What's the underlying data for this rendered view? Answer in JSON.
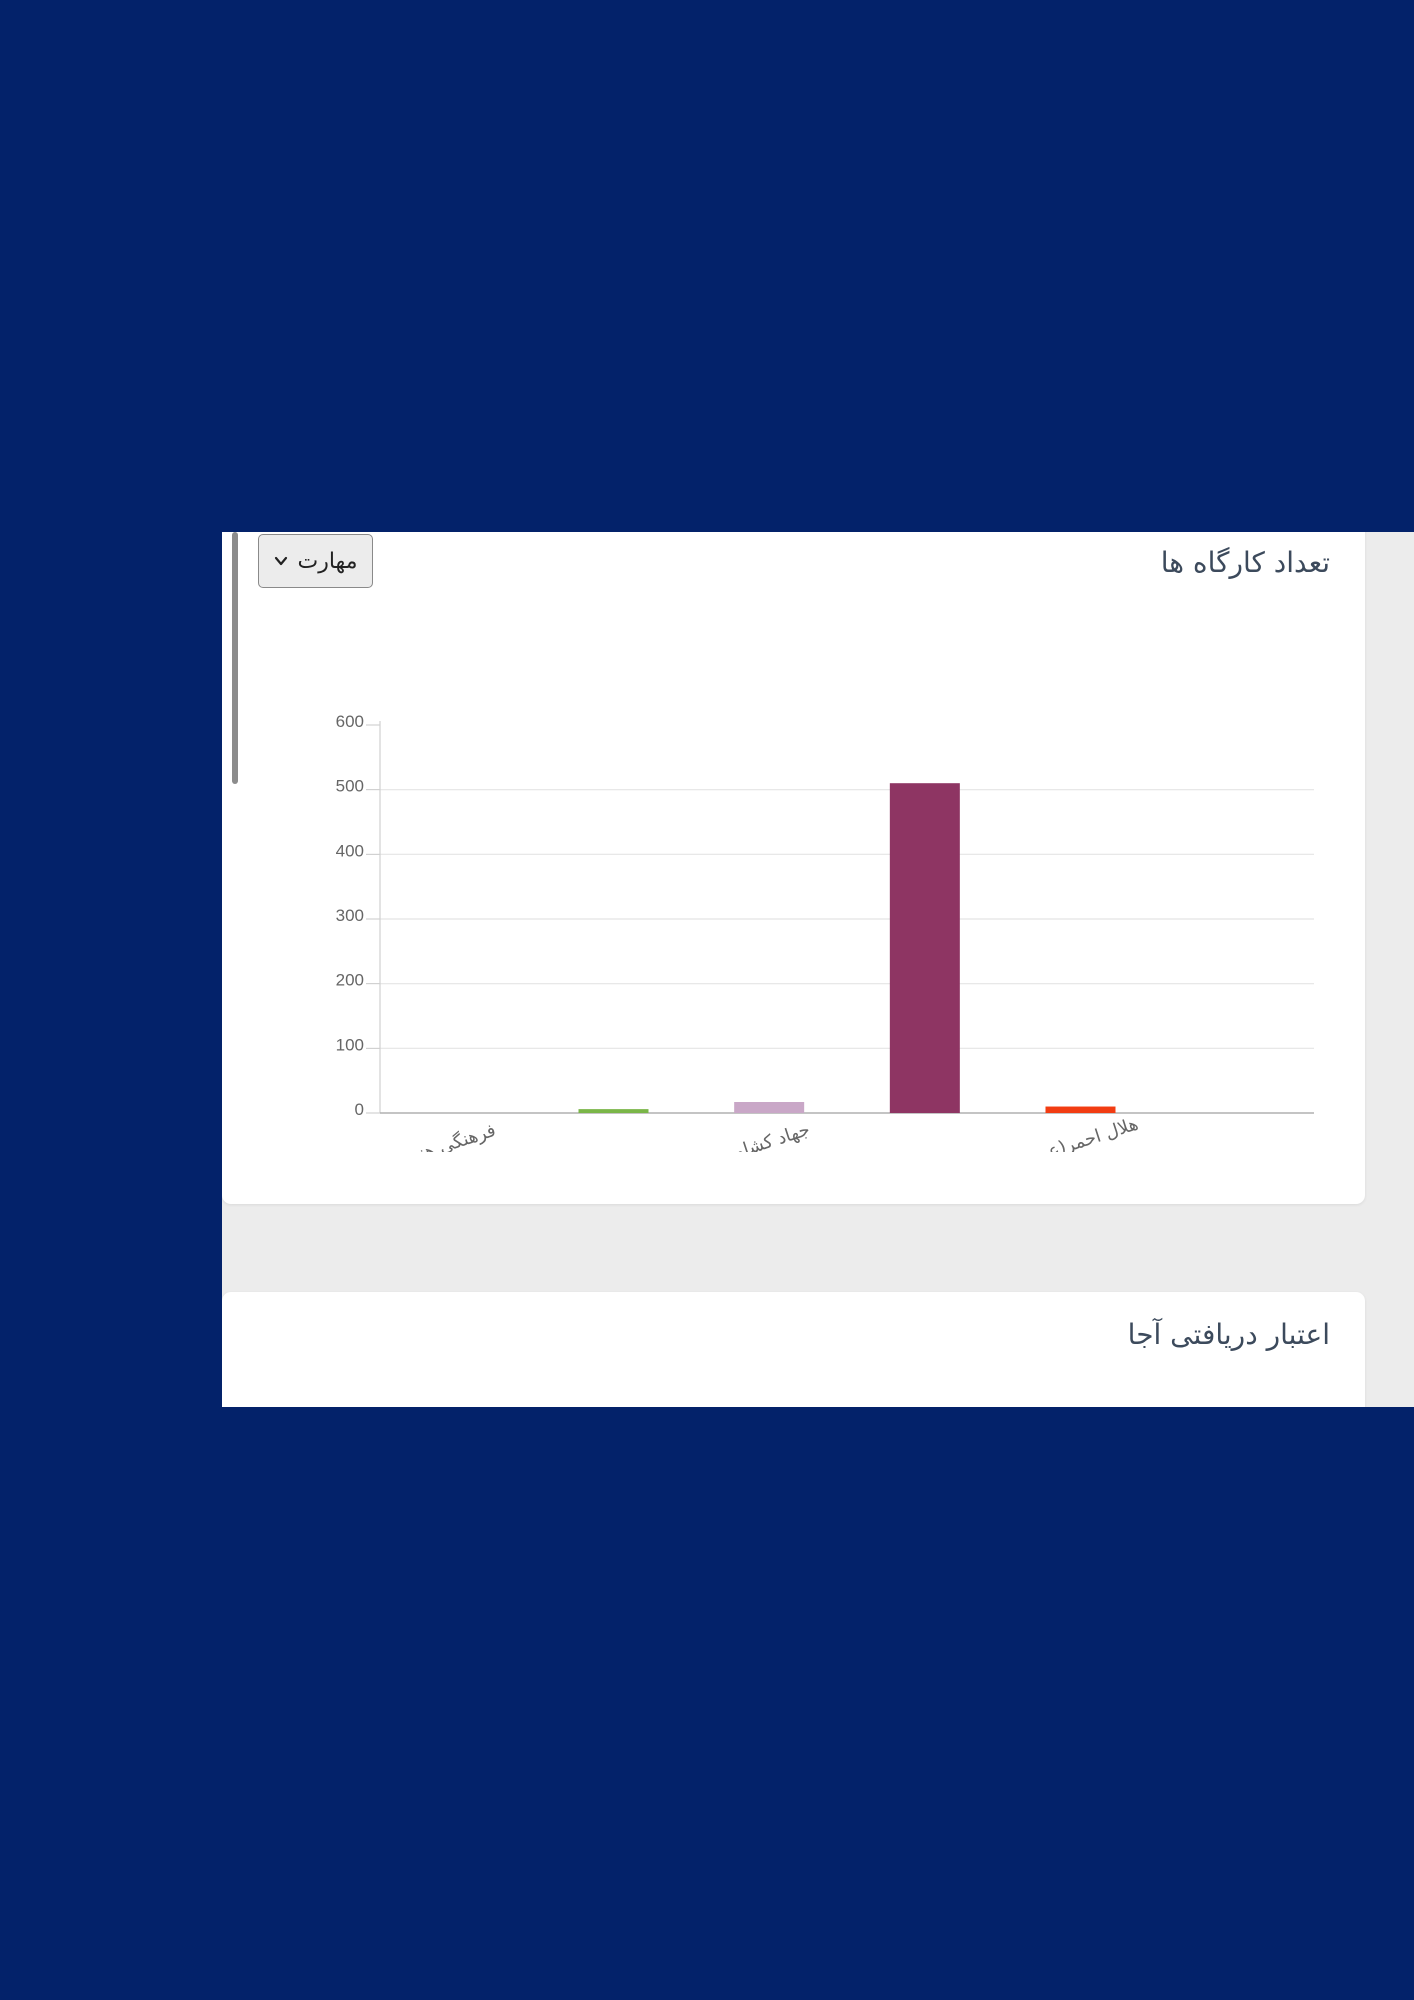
{
  "workshops_card": {
    "title": "تعداد کارگاه ها",
    "filter": {
      "selected": "مهارت",
      "chevron_icon": "chevron-down-icon"
    }
  },
  "credit_card": {
    "title": "اعتبار دریافتی آجا"
  },
  "colors": {
    "page_background": "#03226a",
    "panel_background": "#ececec",
    "card_background": "#ffffff"
  },
  "chart_data": {
    "type": "bar",
    "categories": [
      "فرهنگی هنری",
      "",
      "جهاد کشاورزی",
      "",
      "هلال احمر(عمومی)",
      ""
    ],
    "values": [
      0,
      6,
      17,
      510,
      10,
      0
    ],
    "colors": [
      "#7ab648",
      "#7ab648",
      "#c9a7c7",
      "#8e3563",
      "#f23c12",
      "#f23c12"
    ],
    "yticks": [
      0,
      100,
      200,
      300,
      400,
      500,
      600
    ],
    "ylim": [
      0,
      600
    ],
    "grid": true,
    "legend": "none"
  }
}
